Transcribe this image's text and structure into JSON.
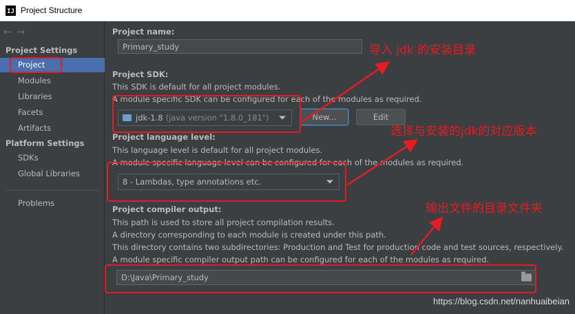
{
  "window": {
    "title": "Project Structure",
    "logo": "IJ"
  },
  "sidebar": {
    "nav": {
      "back": "←",
      "forward": "→"
    },
    "section_project_settings": "Project Settings",
    "items_project": [
      "Project",
      "Modules",
      "Libraries",
      "Facets",
      "Artifacts"
    ],
    "section_platform_settings": "Platform Settings",
    "items_platform": [
      "SDKs",
      "Global Libraries"
    ],
    "items_other": [
      "Problems"
    ],
    "selected": "Project"
  },
  "project_name": {
    "label": "Project name:",
    "value": "Primary_study"
  },
  "project_sdk": {
    "label": "Project SDK:",
    "desc1": "This SDK is default for all project modules.",
    "desc2": "A module specific SDK can be configured for each of the modules as required.",
    "value": "jdk-1.8",
    "detail": "(java version \"1.8.0_181\")",
    "new_label": "New...",
    "edit_label": "Edit"
  },
  "language_level": {
    "label": "Project language level:",
    "desc1": "This language level is default for all project modules.",
    "desc2": "A module specific language level can be configured for each of the modules as required.",
    "value": "8 - Lambdas, type annotations etc."
  },
  "compiler_output": {
    "label": "Project compiler output:",
    "desc1": "This path is used to store all project compilation results.",
    "desc2": "A directory corresponding to each module is created under this path.",
    "desc3": "This directory contains two subdirectories: Production and Test for production code and test sources, respectively.",
    "desc4": "A module specific compiler output path can be configured for each of the modules as required.",
    "value": "D:\\Java\\Primary_study"
  },
  "annotations": {
    "a1": "导入 jdk 的安装目录",
    "a2": "选择与安装的jdk的对应版本",
    "a3": "输出文件的目录文件夹",
    "color": "#e51c23"
  },
  "watermark": "https://blog.csdn.net/nanhuaibeian"
}
